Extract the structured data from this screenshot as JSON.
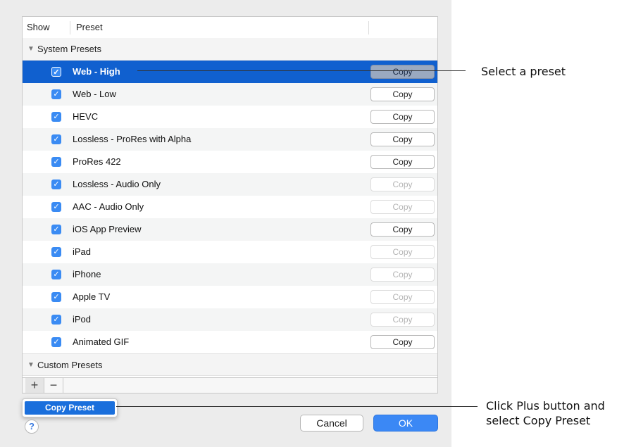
{
  "table": {
    "columns": {
      "show": "Show",
      "preset": "Preset"
    },
    "groups": {
      "system": "System Presets",
      "custom": "Custom Presets"
    },
    "rows": [
      {
        "label": "Web - High",
        "checked": true,
        "copy": "Copy",
        "copy_enabled": true,
        "selected": true
      },
      {
        "label": "Web - Low",
        "checked": true,
        "copy": "Copy",
        "copy_enabled": true
      },
      {
        "label": "HEVC",
        "checked": true,
        "copy": "Copy",
        "copy_enabled": true
      },
      {
        "label": "Lossless - ProRes with Alpha",
        "checked": true,
        "copy": "Copy",
        "copy_enabled": true
      },
      {
        "label": "ProRes 422",
        "checked": true,
        "copy": "Copy",
        "copy_enabled": true
      },
      {
        "label": "Lossless - Audio Only",
        "checked": true,
        "copy": "Copy",
        "copy_enabled": false
      },
      {
        "label": "AAC - Audio Only",
        "checked": true,
        "copy": "Copy",
        "copy_enabled": false
      },
      {
        "label": "iOS App Preview",
        "checked": true,
        "copy": "Copy",
        "copy_enabled": true
      },
      {
        "label": "iPad",
        "checked": true,
        "copy": "Copy",
        "copy_enabled": false
      },
      {
        "label": "iPhone",
        "checked": true,
        "copy": "Copy",
        "copy_enabled": false
      },
      {
        "label": "Apple TV",
        "checked": true,
        "copy": "Copy",
        "copy_enabled": false
      },
      {
        "label": "iPod",
        "checked": true,
        "copy": "Copy",
        "copy_enabled": false
      },
      {
        "label": "Animated GIF",
        "checked": true,
        "copy": "Copy",
        "copy_enabled": true
      }
    ]
  },
  "toolbar": {
    "plus": "+",
    "minus": "−"
  },
  "popup_menu": {
    "item": "Copy Preset"
  },
  "help": "?",
  "buttons": {
    "cancel": "Cancel",
    "ok": "OK"
  },
  "callouts": {
    "select": "Select a preset",
    "plus_line1": "Click Plus button and",
    "plus_line2": "select Copy Preset"
  },
  "colors": {
    "selection": "#1060cf",
    "accent": "#3b88f5"
  }
}
